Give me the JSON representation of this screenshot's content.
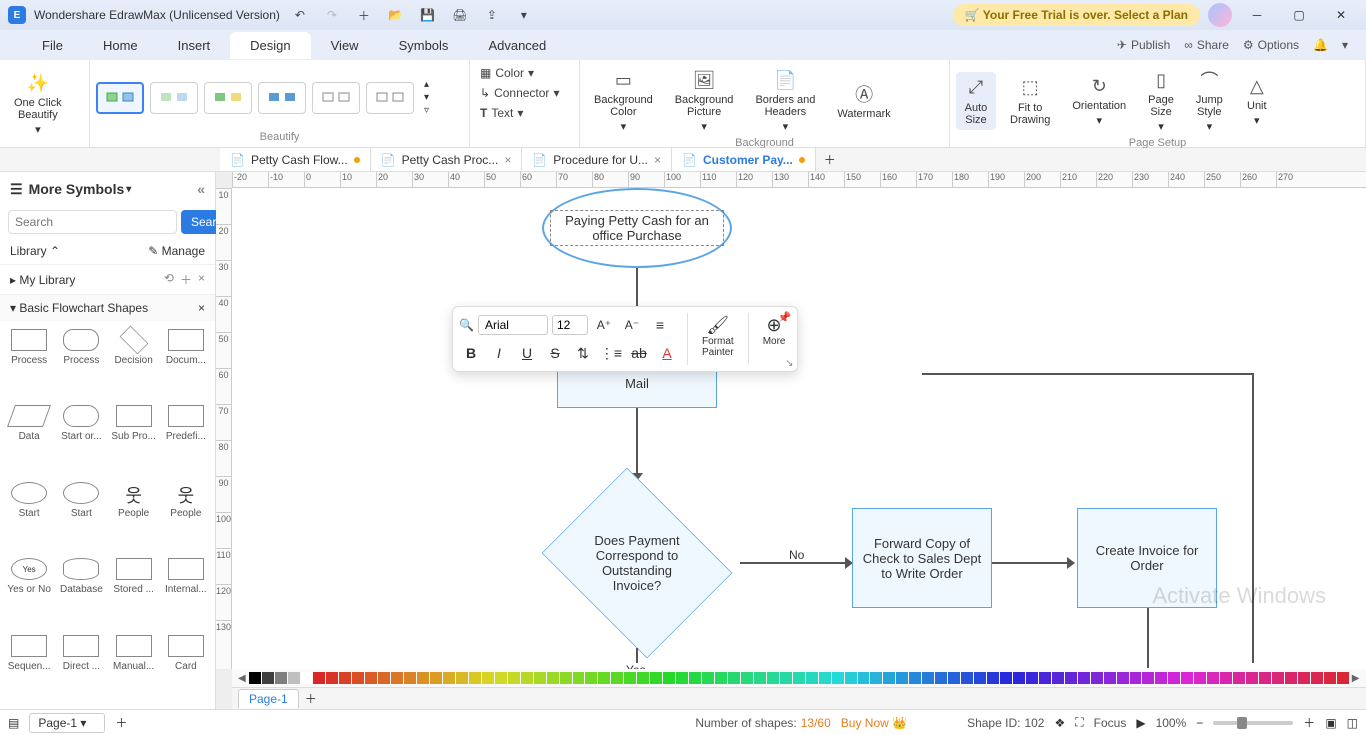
{
  "title": "Wondershare EdrawMax (Unlicensed Version)",
  "trial_banner": "Your Free Trial is over. Select a Plan",
  "menu": {
    "items": [
      "File",
      "Home",
      "Insert",
      "Design",
      "View",
      "Symbols",
      "Advanced"
    ],
    "active": "Design",
    "right": {
      "publish": "Publish",
      "share": "Share",
      "options": "Options"
    }
  },
  "ribbon": {
    "beautify_group": "Beautify",
    "one_click": "One Click\nBeautify",
    "color": "Color",
    "connector": "Connector",
    "text": "Text",
    "bg_color": "Background\nColor",
    "bg_pic": "Background\nPicture",
    "borders": "Borders and\nHeaders",
    "watermark": "Watermark",
    "bg_group": "Background",
    "auto": "Auto\nSize",
    "fit": "Fit to\nDrawing",
    "orient": "Orientation",
    "pgsize": "Page\nSize",
    "jump": "Jump\nStyle",
    "unit": "Unit",
    "ps_group": "Page Setup"
  },
  "doc_tabs": [
    {
      "name": "Petty Cash Flow...",
      "dirty": true,
      "active": false
    },
    {
      "name": "Petty Cash Proc...",
      "dirty": false,
      "active": false
    },
    {
      "name": "Procedure for U...",
      "dirty": false,
      "active": false
    },
    {
      "name": "Customer Pay...",
      "dirty": true,
      "active": true
    }
  ],
  "left": {
    "header": "More Symbols",
    "search_ph": "Search",
    "search_btn": "Search",
    "library": "Library",
    "manage": "Manage",
    "mylib": "My Library",
    "section": "Basic Flowchart Shapes",
    "shapes": [
      [
        "Process",
        "rect"
      ],
      [
        "Process",
        "roundrect"
      ],
      [
        "Decision",
        "diamond"
      ],
      [
        "Docum...",
        "doc"
      ],
      [
        "Data",
        "parallelogram"
      ],
      [
        "Start or...",
        "stadium"
      ],
      [
        "Sub Pro...",
        "subproc"
      ],
      [
        "Predefi...",
        "predef"
      ],
      [
        "Start",
        "ellipse"
      ],
      [
        "Start",
        "circle"
      ],
      [
        "People",
        "person"
      ],
      [
        "People",
        "person2"
      ],
      [
        "Yes or No",
        "yesno"
      ],
      [
        "Database",
        "db"
      ],
      [
        "Stored ...",
        "stored"
      ],
      [
        "Internal...",
        "internal"
      ],
      [
        "Sequen...",
        "seq"
      ],
      [
        "Direct ...",
        "direct"
      ],
      [
        "Manual...",
        "manual"
      ],
      [
        "Card",
        "card"
      ]
    ]
  },
  "ruler_h": [
    "-20",
    "-10",
    "0",
    "10",
    "20",
    "30",
    "40",
    "50",
    "60",
    "70",
    "80",
    "90",
    "100",
    "110",
    "120",
    "130",
    "140",
    "150",
    "160",
    "170",
    "180",
    "190",
    "200",
    "210",
    "220",
    "230",
    "240",
    "250",
    "260",
    "270"
  ],
  "ruler_v": [
    "10",
    "20",
    "30",
    "40",
    "50",
    "60",
    "70",
    "80",
    "90",
    "100",
    "110",
    "120",
    "130"
  ],
  "flow": {
    "start": "Paying Petty Cash for an office Purchase",
    "hidden_box": "Mail",
    "decision": "Does Payment Correspond to Outstanding Invoice?",
    "no": "No",
    "yes": "Yes",
    "forward": "Forward Copy of Check to Sales Dept to Write Order",
    "invoice": "Create Invoice for Order"
  },
  "float": {
    "font": "Arial",
    "size": "12",
    "format": "Format\nPainter",
    "more": "More"
  },
  "colors": [
    "#000",
    "#404040",
    "#7f7f7f",
    "#bfbfbf",
    "#fff",
    "#7f0000",
    "#ff0000",
    "#ff7f00",
    "#ffbf00",
    "#ffff00",
    "#bfff00",
    "#7fff00",
    "#00ff00",
    "#00ff7f",
    "#00ffbf",
    "#00ffff",
    "#00bfff",
    "#007fff",
    "#0000ff",
    "#3f00ff",
    "#7f00ff",
    "#bf00ff",
    "#ff00ff",
    "#ff00bf",
    "#ff007f",
    "#7f3f00",
    "#5f2f00",
    "#3f1f00",
    "#000040",
    "#000080",
    "#400040",
    "#800080"
  ],
  "page_tabs": {
    "current": "Page-1",
    "combo": "Page-1"
  },
  "status": {
    "shapes_label": "Number of shapes:",
    "shapes_val": "13/60",
    "buy": "Buy Now",
    "shapeid_label": "Shape ID:",
    "shapeid_val": "102",
    "focus": "Focus",
    "zoom": "100%"
  },
  "watermark": "Activate Windows"
}
